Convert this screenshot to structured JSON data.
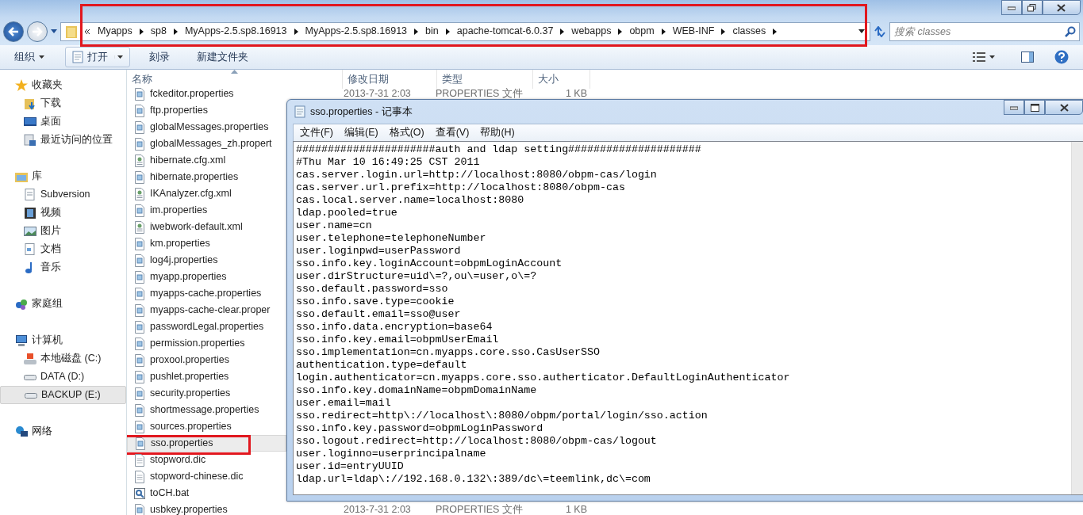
{
  "explorer": {
    "address_bar": {
      "highlighted": true,
      "path": [
        "Myapps",
        "sp8",
        "MyApps-2.5.sp8.16913",
        "MyApps-2.5.sp8.16913",
        "bin",
        "apache-tomcat-6.0.37",
        "webapps",
        "obpm",
        "WEB-INF",
        "classes"
      ]
    },
    "search": {
      "placeholder": "搜索 classes"
    },
    "toolbar": [
      {
        "label": "组织",
        "kind": "menu"
      },
      {
        "label": "打开",
        "kind": "split"
      },
      {
        "label": "刻录",
        "kind": "plain"
      },
      {
        "label": "新建文件夹",
        "kind": "plain"
      }
    ],
    "sidebar": {
      "groups": [
        {
          "label": "收藏夹",
          "kind": "favorites",
          "selected": false,
          "children": [
            {
              "label": "下载",
              "kind": "downloads",
              "selected": false
            },
            {
              "label": "桌面",
              "kind": "desktop",
              "selected": false
            },
            {
              "label": "最近访问的位置",
              "kind": "recent",
              "selected": false
            }
          ]
        },
        {
          "label": "库",
          "kind": "library",
          "selected": false,
          "children": [
            {
              "label": "Subversion",
              "kind": "subversion",
              "selected": false
            },
            {
              "label": "视频",
              "kind": "video",
              "selected": false
            },
            {
              "label": "图片",
              "kind": "pictures",
              "selected": false
            },
            {
              "label": "文档",
              "kind": "documents",
              "selected": false
            },
            {
              "label": "音乐",
              "kind": "music",
              "selected": false
            }
          ]
        },
        {
          "label": "家庭组",
          "kind": "homegroup",
          "selected": false
        },
        {
          "label": "计算机",
          "kind": "computer",
          "selected": false,
          "children": [
            {
              "label": "本地磁盘 (C:)",
              "kind": "system-drive",
              "selected": false
            },
            {
              "label": "DATA (D:)",
              "kind": "drive",
              "selected": false
            },
            {
              "label": "BACKUP (E:)",
              "kind": "drive",
              "selected": true
            }
          ]
        },
        {
          "label": "网络",
          "kind": "network",
          "selected": false
        }
      ]
    },
    "file_list": {
      "columns": [
        "名称",
        "修改日期",
        "类型",
        "大小"
      ],
      "rows": [
        {
          "name": "fckeditor.properties",
          "kind": "properties",
          "date": "2013-7-31 2:03",
          "type": "PROPERTIES 文件",
          "size": "1 KB",
          "selected": false,
          "highlighted": false
        },
        {
          "name": "ftp.properties",
          "kind": "properties",
          "selected": false,
          "highlighted": false
        },
        {
          "name": "globalMessages.properties",
          "kind": "properties",
          "selected": false,
          "highlighted": false
        },
        {
          "name": "globalMessages_zh.propert",
          "kind": "properties",
          "selected": false,
          "highlighted": false
        },
        {
          "name": "hibernate.cfg.xml",
          "kind": "xml",
          "selected": false,
          "highlighted": false
        },
        {
          "name": "hibernate.properties",
          "kind": "properties",
          "selected": false,
          "highlighted": false
        },
        {
          "name": "IKAnalyzer.cfg.xml",
          "kind": "xml",
          "selected": false,
          "highlighted": false
        },
        {
          "name": "im.properties",
          "kind": "properties",
          "selected": false,
          "highlighted": false
        },
        {
          "name": "iwebwork-default.xml",
          "kind": "xml",
          "selected": false,
          "highlighted": false
        },
        {
          "name": "km.properties",
          "kind": "properties",
          "selected": false,
          "highlighted": false
        },
        {
          "name": "log4j.properties",
          "kind": "properties",
          "selected": false,
          "highlighted": false
        },
        {
          "name": "myapp.properties",
          "kind": "properties",
          "selected": false,
          "highlighted": false
        },
        {
          "name": "myapps-cache.properties",
          "kind": "properties",
          "selected": false,
          "highlighted": false
        },
        {
          "name": "myapps-cache-clear.proper",
          "kind": "properties",
          "selected": false,
          "highlighted": false
        },
        {
          "name": "passwordLegal.properties",
          "kind": "properties",
          "selected": false,
          "highlighted": false
        },
        {
          "name": "permission.properties",
          "kind": "properties",
          "selected": false,
          "highlighted": false
        },
        {
          "name": "proxool.properties",
          "kind": "properties",
          "selected": false,
          "highlighted": false
        },
        {
          "name": "pushlet.properties",
          "kind": "properties",
          "selected": false,
          "highlighted": false
        },
        {
          "name": "security.properties",
          "kind": "properties",
          "selected": false,
          "highlighted": false
        },
        {
          "name": "shortmessage.properties",
          "kind": "properties",
          "selected": false,
          "highlighted": false
        },
        {
          "name": "sources.properties",
          "kind": "properties",
          "selected": false,
          "highlighted": false
        },
        {
          "name": "sso.properties",
          "kind": "properties",
          "selected": true,
          "highlighted": true
        },
        {
          "name": "stopword.dic",
          "kind": "text",
          "selected": false,
          "highlighted": false
        },
        {
          "name": "stopword-chinese.dic",
          "kind": "text",
          "selected": false,
          "highlighted": false
        },
        {
          "name": "toCH.bat",
          "kind": "batch",
          "selected": false,
          "highlighted": false
        },
        {
          "name": "usbkey.properties",
          "kind": "properties",
          "date": "2013-7-31 2:03",
          "type": "PROPERTIES 文件",
          "size": "1 KB",
          "selected": false,
          "highlighted": false
        }
      ]
    }
  },
  "notepad": {
    "title": "sso.properties - 记事本",
    "menu": [
      "文件(F)",
      "编辑(E)",
      "格式(O)",
      "查看(V)",
      "帮助(H)"
    ],
    "lines": [
      "######################auth and ldap setting#####################",
      "#Thu Mar 10 16:49:25 CST 2011",
      "cas.server.login.url=http://localhost:8080/obpm-cas/login",
      "cas.server.url.prefix=http://localhost:8080/obpm-cas",
      "cas.local.server.name=localhost:8080",
      "ldap.pooled=true",
      "user.name=cn",
      "user.telephone=telephoneNumber",
      "user.loginpwd=userPassword",
      "sso.info.key.loginAccount=obpmLoginAccount",
      "user.dirStructure=uid\\=?,ou\\=user,o\\=?",
      "sso.default.password=sso",
      "sso.info.save.type=cookie",
      "sso.default.email=sso@user",
      "sso.info.data.encryption=base64",
      "sso.info.key.email=obpmUserEmail",
      "sso.implementation=cn.myapps.core.sso.CasUserSSO",
      "authentication.type=default",
      "login.authenticator=cn.myapps.core.sso.autherticator.DefaultLoginAuthenticator",
      "sso.info.key.domainName=obpmDomainName",
      "user.email=mail",
      "sso.redirect=http\\://localhost\\:8080/obpm/portal/login/sso.action",
      "sso.info.key.password=obpmLoginPassword",
      "sso.logout.redirect=http://localhost:8080/obpm-cas/logout",
      "user.loginno=userprincipalname",
      "user.id=entryUUID",
      "ldap.url=ldap\\://192.168.0.132\\:389/dc\\=teemlink,dc\\=com"
    ]
  }
}
